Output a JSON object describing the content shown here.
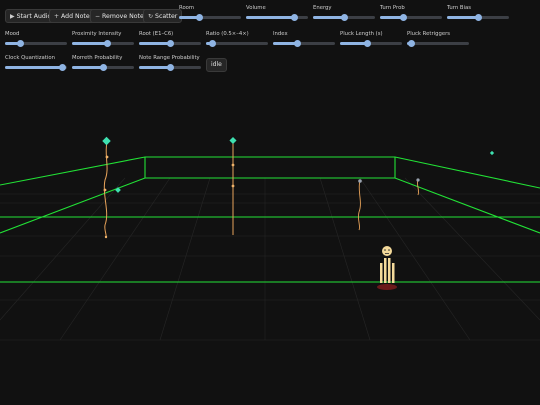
{
  "buttons": [
    {
      "label": "Start Audio",
      "icon": "▶",
      "icon_name": "play-icon"
    },
    {
      "label": "Add Note",
      "icon": "+",
      "icon_name": "plus-icon"
    },
    {
      "label": "Remove Note",
      "icon": "−",
      "icon_name": "minus-icon"
    },
    {
      "label": "Scatter",
      "icon": "↻",
      "icon_name": "scatter-icon"
    }
  ],
  "sliders_row1": [
    {
      "label": "Room",
      "value": 0.33
    },
    {
      "label": "Volume",
      "value": 0.78
    },
    {
      "label": "Energy",
      "value": 0.5
    },
    {
      "label": "Turn Prob",
      "value": 0.38
    },
    {
      "label": "Turn Bias",
      "value": 0.5
    }
  ],
  "sliders_row2": [
    {
      "label": "Mood",
      "value": 0.25
    },
    {
      "label": "Proximity Intensity",
      "value": 0.58
    },
    {
      "label": "Root (E1–C6)",
      "value": 0.5
    },
    {
      "label": "Ratio (0.5×–4×)",
      "value": 0.1
    },
    {
      "label": "Index",
      "value": 0.4
    },
    {
      "label": "Pluck Length (s)",
      "value": 0.45
    },
    {
      "label": "Pluck Retriggers",
      "value": 0.07
    }
  ],
  "sliders_row3": [
    {
      "label": "Clock Quantization",
      "value": 0.92
    },
    {
      "label": "Morreth Probability",
      "value": 0.5
    },
    {
      "label": "Note Range Probability",
      "value": 0.5
    }
  ],
  "status": "idle",
  "colors": {
    "accent": "#8fb4e3",
    "grid": "#22e236",
    "background": "#111111",
    "string": "#e8a35a",
    "note": "#3ee0b0"
  }
}
